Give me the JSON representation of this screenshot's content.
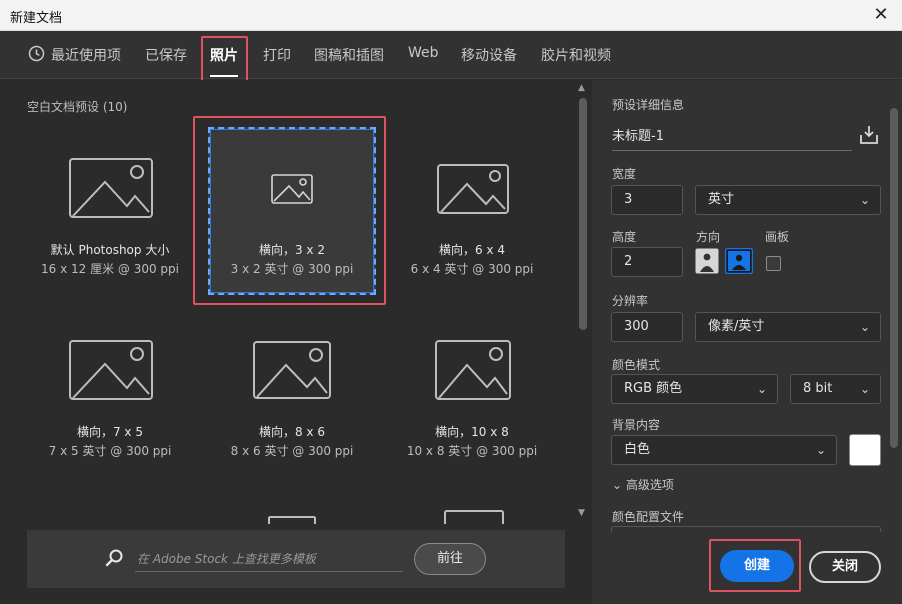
{
  "window": {
    "title": "新建文档",
    "close_glyph": "✕"
  },
  "tabs": [
    {
      "label": "最近使用项"
    },
    {
      "label": "已保存"
    },
    {
      "label": "照片"
    },
    {
      "label": "打印"
    },
    {
      "label": "图稿和插图"
    },
    {
      "label": "Web"
    },
    {
      "label": "移动设备"
    },
    {
      "label": "胶片和视频"
    }
  ],
  "presets": {
    "section_title": "空白文档预设 (10)",
    "items": [
      {
        "name": "默认 Photoshop 大小",
        "sub": "16 x 12 厘米 @ 300 ppi"
      },
      {
        "name": "横向，3 x 2",
        "sub": "3 x 2 英寸 @ 300 ppi"
      },
      {
        "name": "横向，6 x 4",
        "sub": "6 x 4 英寸 @ 300 ppi"
      },
      {
        "name": "横向，7 x 5",
        "sub": "7 x 5 英寸 @ 300 ppi"
      },
      {
        "name": "横向，8 x 6",
        "sub": "8 x 6 英寸 @ 300 ppi"
      },
      {
        "name": "横向，10 x 8",
        "sub": "10 x 8 英寸 @ 300 ppi"
      }
    ]
  },
  "search": {
    "placeholder": "在 Adobe Stock 上查找更多模板",
    "go_label": "前往"
  },
  "details": {
    "section_title": "预设详细信息",
    "doc_name": "未标题-1",
    "width_label": "宽度",
    "width_value": "3",
    "width_unit": "英寸",
    "height_label": "高度",
    "height_value": "2",
    "orientation_label": "方向",
    "artboard_label": "画板",
    "resolution_label": "分辨率",
    "resolution_value": "300",
    "resolution_unit": "像素/英寸",
    "color_mode_label": "颜色模式",
    "color_mode_value": "RGB 颜色",
    "bit_depth_value": "8 bit",
    "background_label": "背景内容",
    "background_value": "白色",
    "background_color": "#ffffff",
    "advanced_label": "高级选项",
    "color_profile_label": "颜色配置文件"
  },
  "actions": {
    "create_label": "创建",
    "close_label": "关闭"
  },
  "colors": {
    "accent": "#1473e6",
    "highlight": "#e05260"
  }
}
